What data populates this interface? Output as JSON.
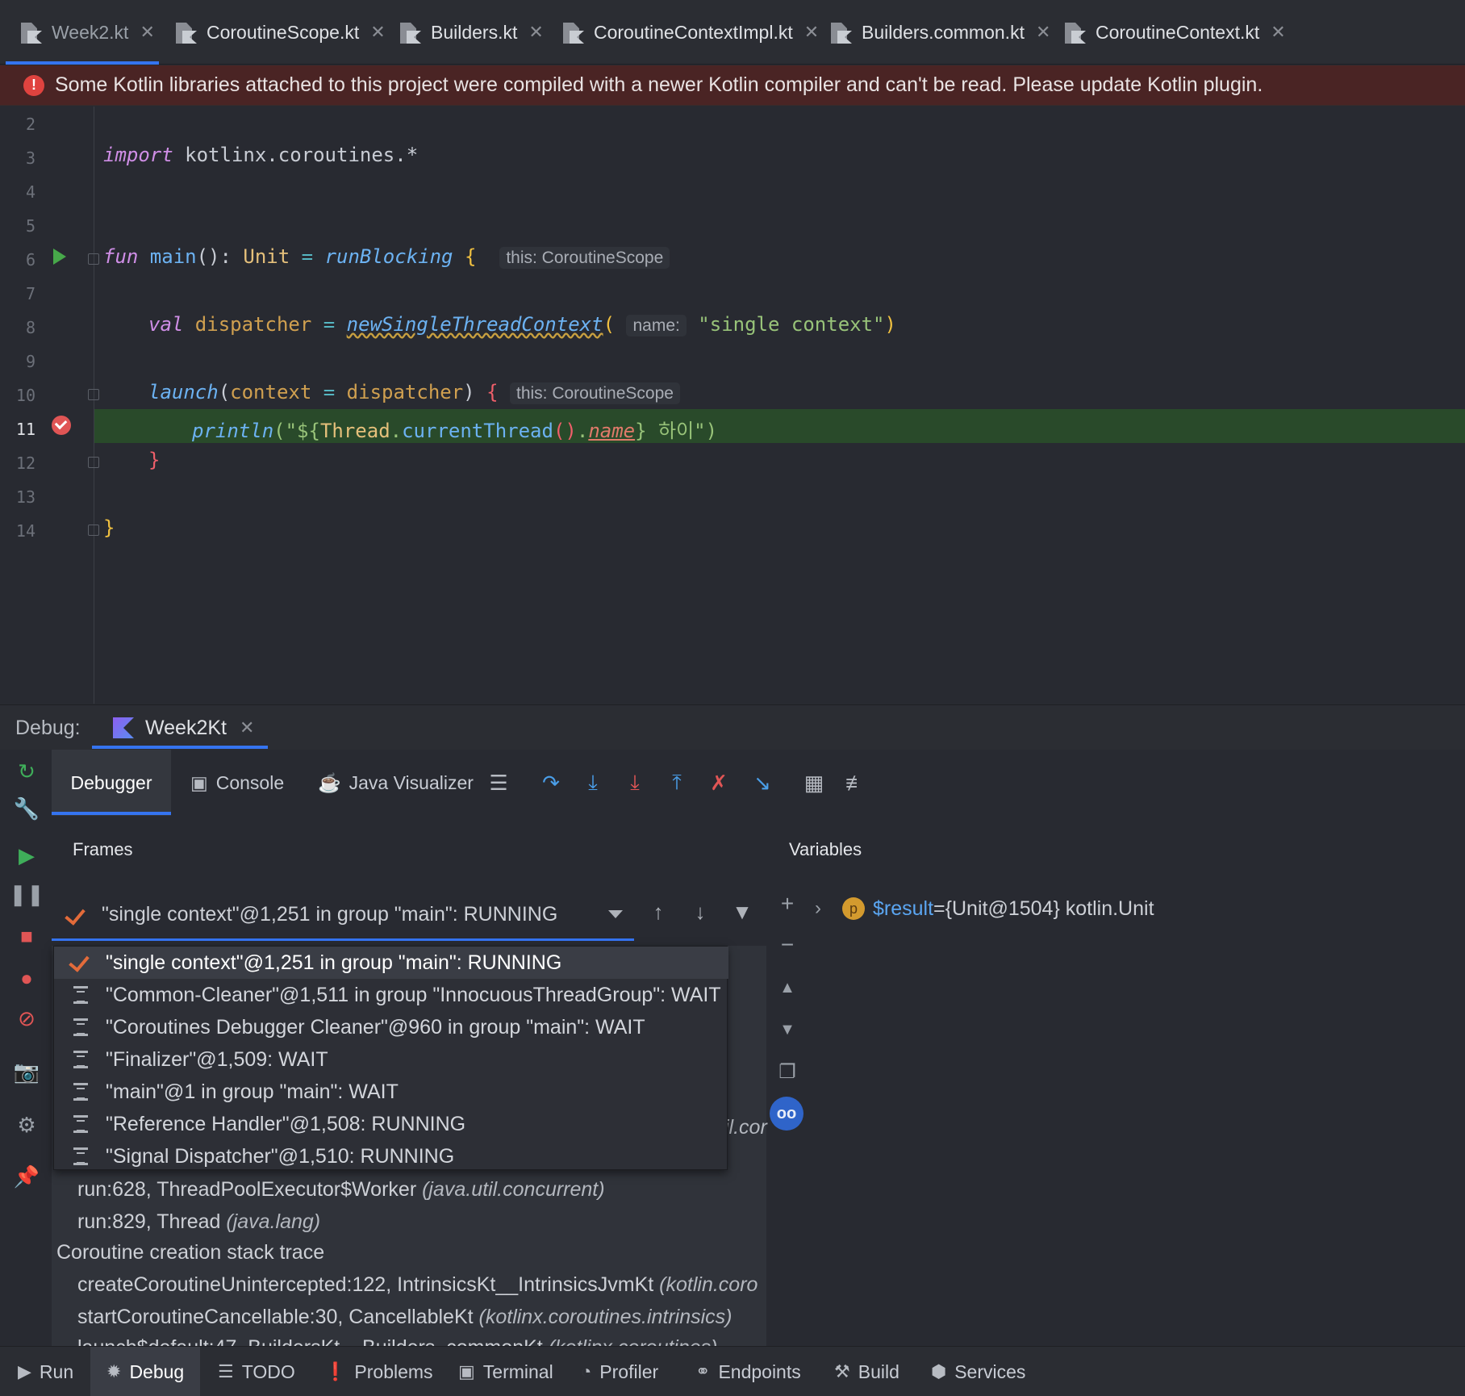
{
  "editor_tabs": [
    {
      "label": "Week2.kt"
    },
    {
      "label": "CoroutineScope.kt"
    },
    {
      "label": "Builders.kt"
    },
    {
      "label": "CoroutineContextImpl.kt"
    },
    {
      "label": "Builders.common.kt"
    },
    {
      "label": "CoroutineContext.kt"
    }
  ],
  "banner": {
    "text": "Some Kotlin libraries attached to this project were compiled with a newer Kotlin compiler and can't be read. Please update Kotlin plugin."
  },
  "code": {
    "line_numbers": [
      "2",
      "3",
      "4",
      "5",
      "6",
      "7",
      "8",
      "9",
      "10",
      "11",
      "12",
      "13",
      "14"
    ],
    "l3_kw": "import",
    "l3_rest": " kotlinx.coroutines.*",
    "l6_fun": "fun",
    "l6_main": " main",
    "l6_paren": "(): ",
    "l6_unit": "Unit",
    "l6_eq": " = ",
    "l6_rb": "runBlocking",
    "l6_brace": " {",
    "l6_hint": "this: CoroutineScope",
    "l8_val": "val",
    "l8_name": " dispatcher",
    "l8_eq": " = ",
    "l8_fn": "newSingleThreadContext",
    "l8_po": "(",
    "l8_hint": "name:",
    "l8_str": "\"single context\"",
    "l8_pc": ")",
    "l10_launch": "launch",
    "l10_a": "(",
    "l10_ctx": "context",
    "l10_b": " = ",
    "l10_disp": "dispatcher",
    "l10_c": ") ",
    "l10_brace": "{",
    "l10_hint": "this: CoroutineScope",
    "l11_println": "println",
    "l11_a": "(\"${",
    "l11_thread": "Thread",
    "l11_dot": ".",
    "l11_ct": "currentThread",
    "l11_pp": "()",
    "l11_dot2": ".",
    "l11_name": "name",
    "l11_b": "} 하이\")",
    "l12_brace": "}",
    "l14_brace": "}"
  },
  "debug": {
    "label": "Debug:",
    "session_tab": "Week2Kt",
    "toolbar_tabs": {
      "debugger": "Debugger",
      "console": "Console",
      "java_visualizer": "Java Visualizer"
    },
    "frames_title": "Frames",
    "variables_title": "Variables",
    "selected_thread": "\"single context\"@1,251 in group \"main\": RUNNING",
    "threads": [
      {
        "label": "\"single context\"@1,251 in group \"main\": RUNNING",
        "selected": true
      },
      {
        "label": "\"Common-Cleaner\"@1,511 in group \"InnocuousThreadGroup\": WAIT"
      },
      {
        "label": "\"Coroutines Debugger Cleaner\"@960 in group \"main\": WAIT"
      },
      {
        "label": "\"Finalizer\"@1,509: WAIT"
      },
      {
        "label": "\"main\"@1 in group \"main\": WAIT"
      },
      {
        "label": "\"Reference Handler\"@1,508: RUNNING"
      },
      {
        "label": "\"Signal Dispatcher\"@1,510: RUNNING"
      }
    ],
    "frames": [
      {
        "method": "run:628, ThreadPoolExecutor$Worker ",
        "pkg": "(java.util.concurrent)"
      },
      {
        "method": "run:829, Thread ",
        "pkg": "(java.lang)"
      }
    ],
    "creation_trace_label": "Coroutine creation stack trace",
    "creation_frames": [
      {
        "method": "createCoroutineUnintercepted:122, IntrinsicsKt__IntrinsicsJvmKt ",
        "pkg": "(kotlin.coro"
      },
      {
        "method": "startCoroutineCancellable:30, CancellableKt ",
        "pkg": "(kotlinx.coroutines.intrinsics)"
      },
      {
        "method": "launch$default:47, BuildersKt__Builders_commonKt ",
        "pkg": "(kotlinx.coroutines)"
      }
    ],
    "partial_text": "il.cor",
    "variable": {
      "name": "$result",
      "eq": " = ",
      "value": "{Unit@1504} kotlin.Unit",
      "badge": "p"
    }
  },
  "bottom_bar": [
    {
      "label": "Run",
      "icon": "play-icon"
    },
    {
      "label": "Debug",
      "icon": "bug-icon"
    },
    {
      "label": "TODO",
      "icon": "list-icon"
    },
    {
      "label": "Problems",
      "icon": "warning-icon"
    },
    {
      "label": "Terminal",
      "icon": "terminal-icon"
    },
    {
      "label": "Profiler",
      "icon": "profiler-icon"
    },
    {
      "label": "Endpoints",
      "icon": "endpoints-icon"
    },
    {
      "label": "Build",
      "icon": "hammer-icon"
    },
    {
      "label": "Services",
      "icon": "services-icon"
    }
  ],
  "colors": {
    "accent": "#3574f0",
    "banner_bg": "#4a2424",
    "current_line": "#294a2a",
    "breakpoint": "#e05555"
  }
}
